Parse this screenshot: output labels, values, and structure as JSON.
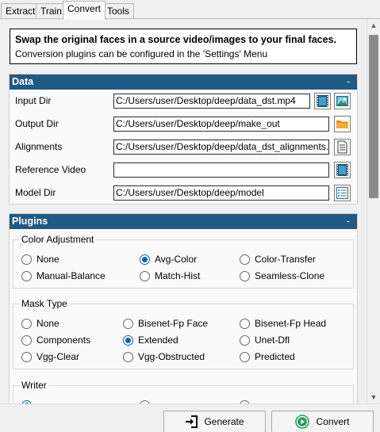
{
  "tabs": [
    {
      "label": "Extract"
    },
    {
      "label": "Train"
    },
    {
      "label": "Convert"
    },
    {
      "label": "Tools"
    }
  ],
  "active_tab": "Convert",
  "info": {
    "title": "Swap the original faces in a source video/images to your final faces.",
    "text": "Conversion plugins can be configured in the 'Settings' Menu"
  },
  "data_section": {
    "title": "Data",
    "collapse": "-",
    "rows": [
      {
        "label": "Input Dir",
        "value": "C:/Users/user/Desktop/deep/data_dst.mp4"
      },
      {
        "label": "Output Dir",
        "value": "C:/Users/user/Desktop/deep/make_out"
      },
      {
        "label": "Alignments",
        "value": "C:/Users/user/Desktop/deep/data_dst_alignments.fsa"
      },
      {
        "label": "Reference Video",
        "value": ""
      },
      {
        "label": "Model Dir",
        "value": "C:/Users/user/Desktop/deep/model"
      }
    ]
  },
  "plugins_section": {
    "title": "Plugins",
    "collapse": "-",
    "color_adjustment": {
      "title": "Color Adjustment",
      "options": [
        "None",
        "Avg-Color",
        "Color-Transfer",
        "Manual-Balance",
        "Match-Hist",
        "Seamless-Clone"
      ],
      "selected": "Avg-Color"
    },
    "mask_type": {
      "title": "Mask Type",
      "options": [
        "None",
        "Bisenet-Fp Face",
        "Bisenet-Fp Head",
        "Components",
        "Extended",
        "Unet-Dfl",
        "Vgg-Clear",
        "Vgg-Obstructed",
        "Predicted"
      ],
      "selected": "Extended"
    },
    "writer": {
      "title": "Writer"
    }
  },
  "buttons": {
    "generate": "Generate",
    "convert": "Convert"
  },
  "colors": {
    "section_header": "#1f5984",
    "radio_checked": "#0062b8",
    "convert_icon": "#1e9e5a"
  }
}
